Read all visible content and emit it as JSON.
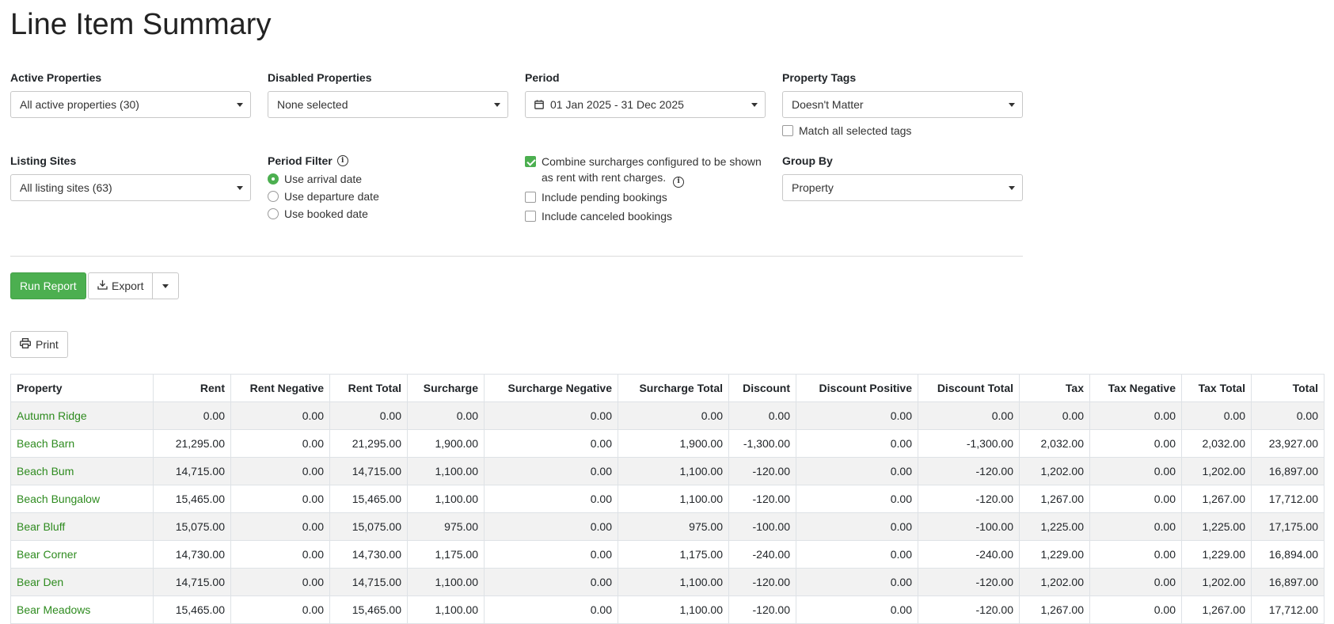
{
  "page": {
    "title": "Line Item Summary"
  },
  "filters": {
    "active_properties": {
      "label": "Active Properties",
      "value": "All active properties (30)"
    },
    "disabled_properties": {
      "label": "Disabled Properties",
      "value": "None selected"
    },
    "period": {
      "label": "Period",
      "value": "01 Jan 2025 - 31 Dec 2025"
    },
    "property_tags": {
      "label": "Property Tags",
      "value": "Doesn't Matter",
      "match_all_label": "Match all selected tags",
      "match_all_checked": false
    },
    "listing_sites": {
      "label": "Listing Sites",
      "value": "All listing sites (63)"
    },
    "period_filter": {
      "label": "Period Filter",
      "options": [
        {
          "label": "Use arrival date",
          "checked": true
        },
        {
          "label": "Use departure date",
          "checked": false
        },
        {
          "label": "Use booked date",
          "checked": false
        }
      ]
    },
    "options": {
      "combine_surcharges": {
        "label_line1": "Combine surcharges configured to be shown",
        "label_line2": "as rent with rent charges.",
        "checked": true
      },
      "include_pending": {
        "label": "Include pending bookings",
        "checked": false
      },
      "include_canceled": {
        "label": "Include canceled bookings",
        "checked": false
      }
    },
    "group_by": {
      "label": "Group By",
      "value": "Property"
    }
  },
  "actions": {
    "run_report": "Run Report",
    "export": "Export",
    "print": "Print"
  },
  "table": {
    "columns": [
      "Property",
      "Rent",
      "Rent Negative",
      "Rent Total",
      "Surcharge",
      "Surcharge Negative",
      "Surcharge Total",
      "Discount",
      "Discount Positive",
      "Discount Total",
      "Tax",
      "Tax Negative",
      "Tax Total",
      "Total"
    ],
    "rows": [
      [
        "Autumn Ridge",
        "0.00",
        "0.00",
        "0.00",
        "0.00",
        "0.00",
        "0.00",
        "0.00",
        "0.00",
        "0.00",
        "0.00",
        "0.00",
        "0.00",
        "0.00"
      ],
      [
        "Beach Barn",
        "21,295.00",
        "0.00",
        "21,295.00",
        "1,900.00",
        "0.00",
        "1,900.00",
        "-1,300.00",
        "0.00",
        "-1,300.00",
        "2,032.00",
        "0.00",
        "2,032.00",
        "23,927.00"
      ],
      [
        "Beach Bum",
        "14,715.00",
        "0.00",
        "14,715.00",
        "1,100.00",
        "0.00",
        "1,100.00",
        "-120.00",
        "0.00",
        "-120.00",
        "1,202.00",
        "0.00",
        "1,202.00",
        "16,897.00"
      ],
      [
        "Beach Bungalow",
        "15,465.00",
        "0.00",
        "15,465.00",
        "1,100.00",
        "0.00",
        "1,100.00",
        "-120.00",
        "0.00",
        "-120.00",
        "1,267.00",
        "0.00",
        "1,267.00",
        "17,712.00"
      ],
      [
        "Bear Bluff",
        "15,075.00",
        "0.00",
        "15,075.00",
        "975.00",
        "0.00",
        "975.00",
        "-100.00",
        "0.00",
        "-100.00",
        "1,225.00",
        "0.00",
        "1,225.00",
        "17,175.00"
      ],
      [
        "Bear Corner",
        "14,730.00",
        "0.00",
        "14,730.00",
        "1,175.00",
        "0.00",
        "1,175.00",
        "-240.00",
        "0.00",
        "-240.00",
        "1,229.00",
        "0.00",
        "1,229.00",
        "16,894.00"
      ],
      [
        "Bear Den",
        "14,715.00",
        "0.00",
        "14,715.00",
        "1,100.00",
        "0.00",
        "1,100.00",
        "-120.00",
        "0.00",
        "-120.00",
        "1,202.00",
        "0.00",
        "1,202.00",
        "16,897.00"
      ],
      [
        "Bear Meadows",
        "15,465.00",
        "0.00",
        "15,465.00",
        "1,100.00",
        "0.00",
        "1,100.00",
        "-120.00",
        "0.00",
        "-120.00",
        "1,267.00",
        "0.00",
        "1,267.00",
        "17,712.00"
      ]
    ]
  },
  "colors": {
    "accent": "#4caf50",
    "link": "#2e8b1f",
    "muted": "#9a9a9a"
  },
  "icons": {
    "period": "calendar-icon",
    "export": "download-icon",
    "print": "printer-icon",
    "info": "info-icon"
  }
}
